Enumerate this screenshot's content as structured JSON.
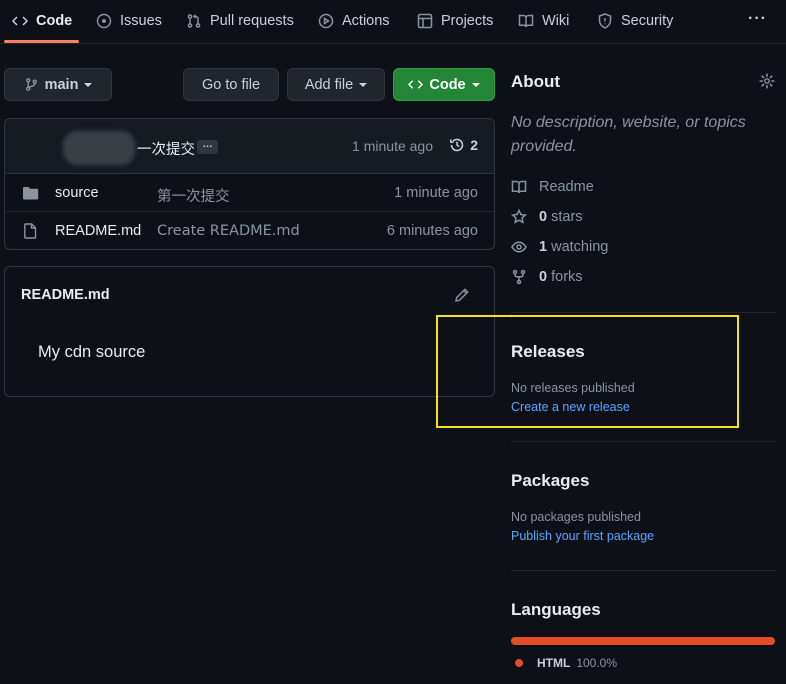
{
  "nav": {
    "tabs": [
      {
        "label": "Code",
        "icon": "code-icon"
      },
      {
        "label": "Issues",
        "icon": "issue-opened-icon"
      },
      {
        "label": "Pull requests",
        "icon": "git-pull-request-icon"
      },
      {
        "label": "Actions",
        "icon": "play-icon"
      },
      {
        "label": "Projects",
        "icon": "table-icon"
      },
      {
        "label": "Wiki",
        "icon": "book-icon"
      },
      {
        "label": "Security",
        "icon": "shield-icon"
      }
    ],
    "more": "···"
  },
  "toolbar": {
    "branch": "main",
    "goto_file": "Go to file",
    "add_file": "Add file",
    "code": "Code"
  },
  "commit": {
    "message": "一次提交",
    "more": "…",
    "time": "1 minute ago",
    "history_count": "2"
  },
  "files": [
    {
      "name": "source",
      "type": "folder",
      "message": "第一次提交",
      "age": "1 minute ago"
    },
    {
      "name": "README.md",
      "type": "file",
      "message": "Create README.md",
      "age": "6 minutes ago"
    }
  ],
  "readme": {
    "title": "README.md",
    "body": "My cdn source"
  },
  "about": {
    "heading": "About",
    "description": "No description, website, or topics provided.",
    "readme": "Readme",
    "stars_count": "0",
    "stars_label": "stars",
    "watching_count": "1",
    "watching_label": "watching",
    "forks_count": "0",
    "forks_label": "forks"
  },
  "releases": {
    "heading": "Releases",
    "empty": "No releases published",
    "link": "Create a new release"
  },
  "packages": {
    "heading": "Packages",
    "empty": "No packages published",
    "link": "Publish your first package"
  },
  "languages": {
    "heading": "Languages",
    "items": [
      {
        "name": "HTML",
        "percent": "100.0%",
        "color": "#e34c26",
        "share": 100
      }
    ]
  },
  "colors": {
    "background": "#0d1117",
    "accent_green": "#238636",
    "link": "#58a6ff",
    "tab_underline": "#f78166",
    "highlight": "#f2e21a"
  }
}
